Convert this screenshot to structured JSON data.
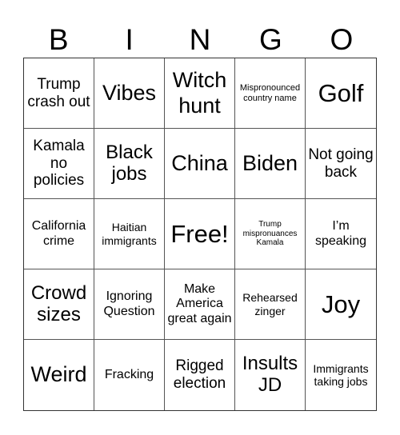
{
  "header": {
    "letters": [
      "B",
      "I",
      "N",
      "G",
      "O"
    ]
  },
  "cells": [
    "Trump crash out",
    "Vibes",
    "Witch hunt",
    "Mispronounced country name",
    "Golf",
    "Kamala no policies",
    "Black jobs",
    "China",
    "Biden",
    "Not going back",
    "California crime",
    "Haitian immigrants",
    "Free!",
    "Trump mispronuances Kamala",
    "I’m speaking",
    "Crowd sizes",
    "Ignoring Question",
    "Make America great again",
    "Rehearsed zinger",
    "Joy",
    "Weird",
    "Fracking",
    "Rigged election",
    "Insults JD",
    "Immigrants taking jobs"
  ]
}
